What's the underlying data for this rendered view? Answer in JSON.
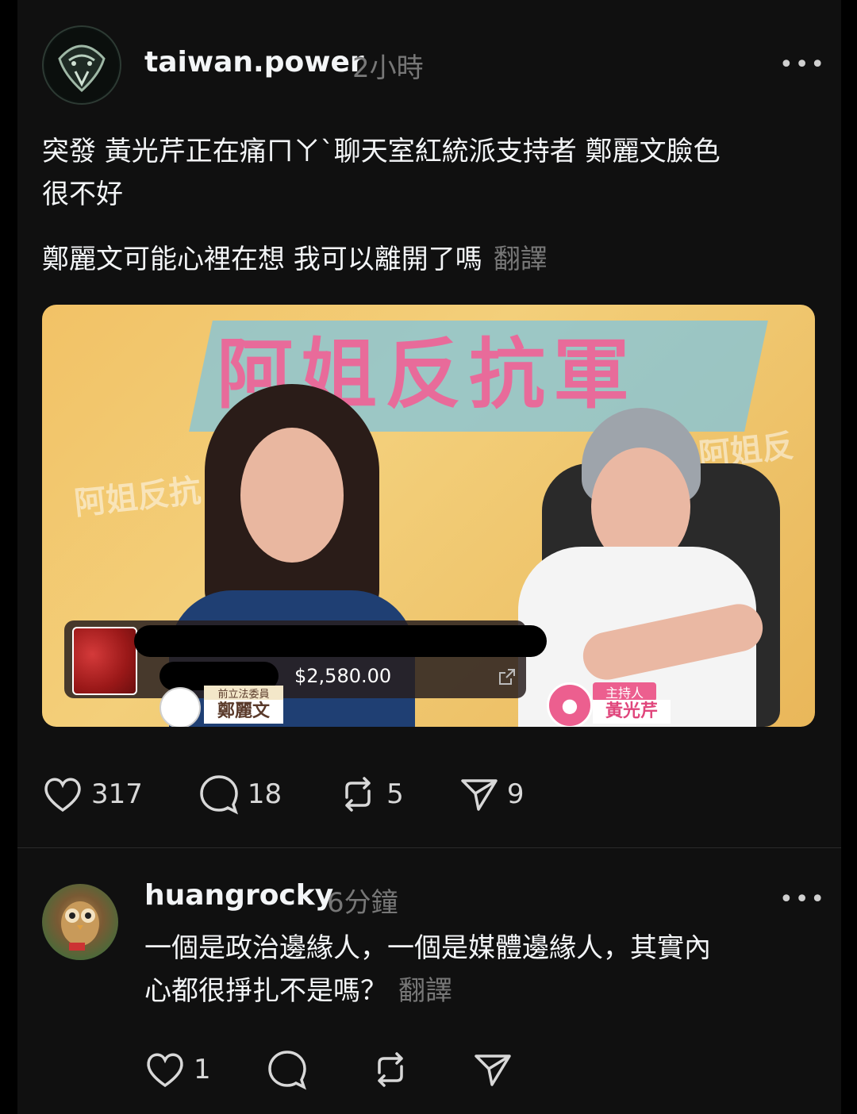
{
  "post": {
    "username": "taiwan.power",
    "time": "2小時",
    "more": "•••",
    "text_line1": "突發 黃光芹正在痛ㄇㄚˋ聊天室紅統派支持者 鄭麗文臉色",
    "text_line2": "很不好",
    "text_line3": "鄭麗文可能心裡在想 我可以離開了嗎",
    "translate": "翻譯",
    "media": {
      "banner": "阿姐反抗軍",
      "watermark": "阿姐反抗",
      "price": "$2,580.00",
      "guest_role": "前立法委員",
      "guest_name": "鄭麗文",
      "host_role": "主持人",
      "host_name": "黃光芹"
    },
    "actions": {
      "likes": "317",
      "comments": "18",
      "reposts": "5",
      "shares": "9"
    }
  },
  "reply": {
    "username": "huangrocky",
    "time": "6分鐘",
    "more": "•••",
    "text_line1": "一個是政治邊緣人，一個是媒體邊緣人，其實內",
    "text_line2": "心都很掙扎不是嗎？",
    "translate": "翻譯",
    "actions": {
      "likes": "1"
    }
  },
  "colors": {
    "background": "#101010",
    "text": "#f3f5f7",
    "muted": "#777777",
    "banner_pink": "#e86b9a"
  }
}
